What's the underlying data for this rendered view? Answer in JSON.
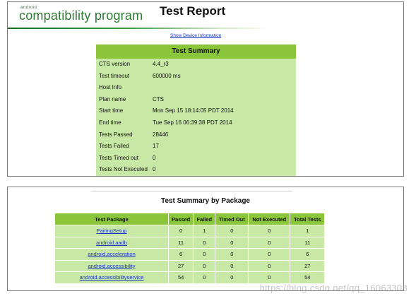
{
  "header": {
    "logo_small": "android",
    "logo_main": "compatibility program",
    "title": "Test Report",
    "device_link": "Show Device Information"
  },
  "summary": {
    "title": "Test Summary",
    "rows": [
      {
        "label": "CTS version",
        "value": "4.4_r3"
      },
      {
        "label": "Test timeout",
        "value": "600000 ms"
      },
      {
        "label": "Host Info",
        "value": ""
      },
      {
        "label": "Plan name",
        "value": "CTS"
      },
      {
        "label": "Start time",
        "value": "Mon Sep 15 18:14:05 PDT 2014"
      },
      {
        "label": "End time",
        "value": "Tue Sep 16 06:39:38 PDT 2014"
      },
      {
        "label": "Tests Passed",
        "value": "28446"
      },
      {
        "label": "Tests Failed",
        "value": "17"
      },
      {
        "label": "Tests Timed out",
        "value": "0"
      },
      {
        "label": "Tests Not Executed",
        "value": "0"
      }
    ]
  },
  "packages": {
    "title": "Test Summary by Package",
    "columns": [
      "Test Package",
      "Passed",
      "Failed",
      "Timed Out",
      "Not Executed",
      "Total Tests"
    ],
    "rows": [
      [
        "PairingSetup",
        "0",
        "1",
        "0",
        "0",
        "1"
      ],
      [
        "android.aadb",
        "11",
        "0",
        "0",
        "0",
        "11"
      ],
      [
        "android.acceleration",
        "6",
        "0",
        "0",
        "0",
        "6"
      ],
      [
        "android.accessibility",
        "27",
        "0",
        "0",
        "0",
        "27"
      ],
      [
        "android.accessibilityservice",
        "54",
        "0",
        "0",
        "0",
        "54"
      ]
    ]
  },
  "watermark": "https://blog.csdn.net/qq_16063303",
  "colors": {
    "header_green": "#8ac53a",
    "row_green": "#c8e8a6",
    "logo_green": "#2d7a35",
    "link_blue": "#1d35c8"
  }
}
